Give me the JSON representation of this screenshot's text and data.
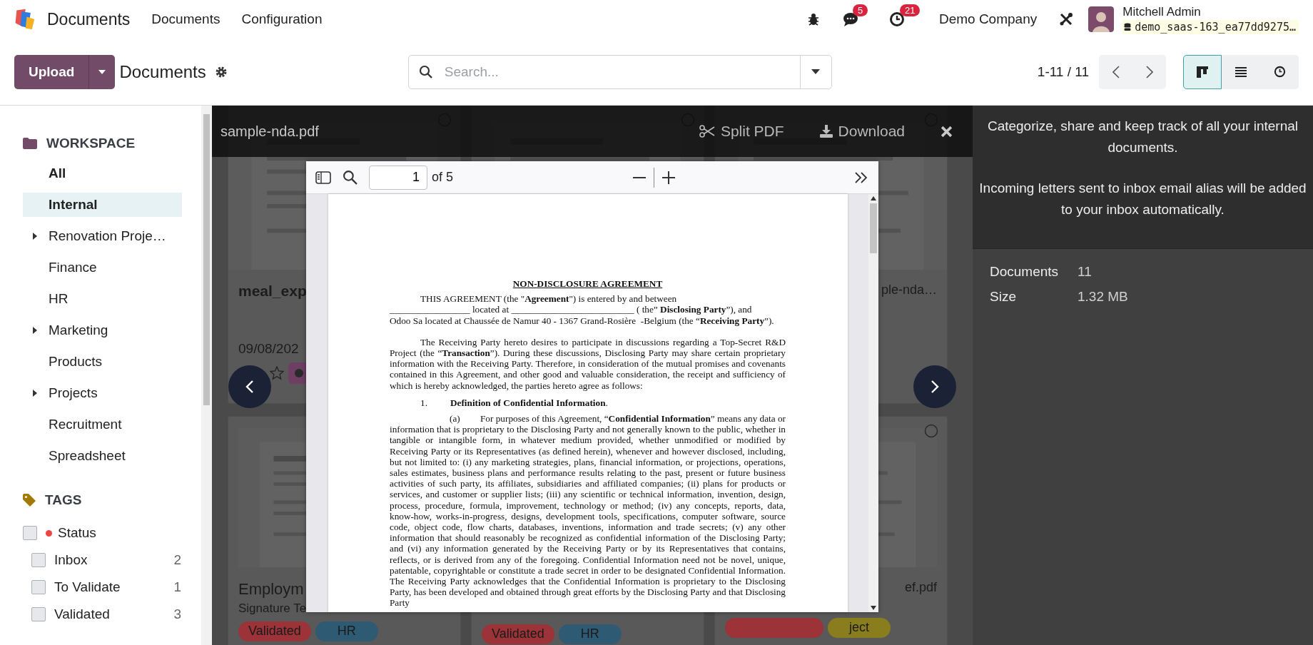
{
  "navbar": {
    "app_name": "Documents",
    "menu": [
      "Documents",
      "Configuration"
    ],
    "messages_count": "5",
    "activities_count": "21",
    "company": "Demo Company",
    "user": {
      "name": "Mitchell Admin",
      "database": "demo_saas-163_ea77dd9275…"
    }
  },
  "control_panel": {
    "upload_label": "Upload",
    "breadcrumb": "Documents",
    "search": {
      "placeholder": "Search..."
    },
    "pager": "1-11 / 11",
    "views": [
      {
        "kind": "kanban",
        "selected": true
      },
      {
        "kind": "list",
        "selected": false
      },
      {
        "kind": "activity",
        "selected": false
      }
    ]
  },
  "sidebar": {
    "workspace_title": "WORKSPACE",
    "workspaces": [
      {
        "label": "All",
        "kind": "root",
        "expandable": false,
        "selected": false
      },
      {
        "label": "Internal",
        "kind": "folder",
        "expandable": false,
        "selected": true
      },
      {
        "label": "Renovation Proje…",
        "kind": "folder",
        "expandable": true,
        "selected": false
      },
      {
        "label": "Finance",
        "kind": "folder",
        "expandable": false,
        "selected": false
      },
      {
        "label": "HR",
        "kind": "folder",
        "expandable": false,
        "selected": false
      },
      {
        "label": "Marketing",
        "kind": "folder",
        "expandable": true,
        "selected": false
      },
      {
        "label": "Products",
        "kind": "folder",
        "expandable": false,
        "selected": false
      },
      {
        "label": "Projects",
        "kind": "folder",
        "expandable": true,
        "selected": false
      },
      {
        "label": "Recruitment",
        "kind": "folder",
        "expandable": false,
        "selected": false
      },
      {
        "label": "Spreadsheet",
        "kind": "folder",
        "expandable": false,
        "selected": false
      }
    ],
    "tags_title": "TAGS",
    "tag_groups": [
      {
        "label": "Status",
        "color": "#ef4444",
        "checked": false,
        "children": [
          {
            "label": "Inbox",
            "count": "2",
            "checked": false
          },
          {
            "label": "To Validate",
            "count": "1",
            "checked": false
          },
          {
            "label": "Validated",
            "count": "3",
            "checked": false
          }
        ]
      }
    ]
  },
  "kanban": {
    "cards": [
      {
        "title": "meal_exp",
        "date": "09/08/202",
        "starred": false,
        "selected": false
      },
      {
        "selected": false
      },
      {
        "title": "ple-nda…",
        "selected": false
      },
      {
        "title": "Employm",
        "subtitle": "Signature Te",
        "tags": [
          {
            "label": "Validated",
            "color": "#9b3338"
          },
          {
            "label": "HR",
            "color": "#2f5a73"
          }
        ]
      },
      {
        "tags": [
          {
            "label": "Validated",
            "color": "#9b3338"
          },
          {
            "label": "HR",
            "color": "#2f5a73"
          }
        ]
      },
      {
        "title": "ef.pdf",
        "tags": [
          {
            "color": "#9b3338"
          },
          {
            "label": "ject",
            "color": "#8a7d1e"
          }
        ],
        "selected": false
      }
    ]
  },
  "viewer": {
    "file_name": "sample-nda.pdf",
    "actions": [
      {
        "kind": "split",
        "label": "Split PDF"
      },
      {
        "kind": "download",
        "label": "Download"
      }
    ],
    "toolbar": {
      "page": "1",
      "page_count": "of 5"
    },
    "document": {
      "heading": "NON-DISCLOSURE AGREEMENT",
      "intro_lines": [
        "THIS AGREEMENT (the \"**Agreement**\") is entered by and between",
        "_________________ located at __________________________ ( the” **Disclosing Party**”), and",
        "Odoo Sa located at Chaussée de Namur 40 - 1367 Grand-Rosière  -Belgium (the “**Receiving Party**”)."
      ],
      "paragraphs": [
        {
          "kind": "body",
          "text": "The Receiving Party hereto desires to participate in discussions regarding a Top-Secret R&D Project (the “**Transaction**”).  During these discussions, Disclosing Party may share certain proprietary information with the Receiving Party.  Therefore, in consideration of the mutual promises and covenants contained in this Agreement, and other good and valuable consideration, the receipt and sufficiency of which is hereby acknowledged, the parties hereto agree as follows:"
        },
        {
          "kind": "section",
          "number": "1.",
          "text": "**Definition of Confidential Information**."
        },
        {
          "kind": "clause",
          "marker": "(a)",
          "text": "For purposes of this Agreement, “**Confidential Information**” means any data or information that is proprietary to the Disclosing Party and not generally known to the public, whether in tangible or intangible form, in whatever medium provided, whether unmodified or modified by Receiving Party or its Representatives (as defined herein), whenever and however disclosed, including, but not limited to: (i) any marketing strategies, plans, financial information, or projections, operations, sales estimates, business plans and performance results relating to the past, present or future business activities of such party, its affiliates, subsidiaries and affiliated companies; (ii) plans for products or services, and customer or supplier lists; (iii) any scientific or technical information, invention, design, process, procedure, formula, improvement, technology or method; (iv) any concepts, reports, data, know-how, works-in-progress, designs, development tools, specifications, computer software, source code, object code, flow charts, databases, inventions, information and trade secrets; (v) any other information that should reasonably be recognized as confidential information of the Disclosing Party; and (vi) any information generated by the Receiving Party or by its Representatives that contains, reflects, or is derived from any of the foregoing.  Confidential Information need not be novel, unique, patentable, copyrightable or constitute a trade secret in order to be designated Confidential Information.  The Receiving Party acknowledges that the Confidential Information is proprietary to the Disclosing Party, has been developed and obtained through great efforts by the Disclosing Party and that Disclosing Party"
        }
      ]
    }
  },
  "info_panel": {
    "messages": [
      "Categorize, share and keep track of all your internal documents.",
      "Incoming letters sent to inbox email alias will be added to your inbox automatically."
    ],
    "stats": [
      {
        "label": "Documents",
        "value": "11"
      },
      {
        "label": "Size",
        "value": "1.32 MB"
      }
    ]
  }
}
